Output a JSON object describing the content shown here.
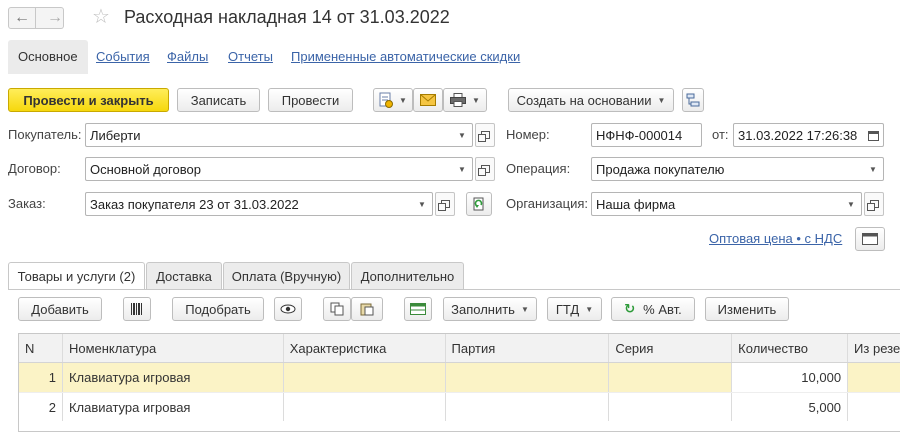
{
  "window": {
    "title": "Расходная накладная 14 от 31.03.2022"
  },
  "sections": [
    {
      "label": "Основное",
      "active": true
    },
    {
      "label": "События"
    },
    {
      "label": "Файлы"
    },
    {
      "label": "Отчеты"
    },
    {
      "label": "Примененные автоматические скидки"
    }
  ],
  "toolbar": {
    "post_close": "Провести и закрыть",
    "save": "Записать",
    "post": "Провести",
    "create_based": "Создать на основании"
  },
  "form": {
    "buyer": {
      "label": "Покупатель:",
      "value": "Либерти"
    },
    "contract": {
      "label": "Договор:",
      "value": "Основной договор"
    },
    "order": {
      "label": "Заказ:",
      "value": "Заказ покупателя 23 от 31.03.2022"
    },
    "number": {
      "label": "Номер:",
      "value": "НФНФ-000014"
    },
    "date": {
      "label": "от:",
      "value": "31.03.2022 17:26:38"
    },
    "operation": {
      "label": "Операция:",
      "value": "Продажа покупателю"
    },
    "organization": {
      "label": "Организация:",
      "value": "Наша фирма"
    },
    "price_type_link": "Оптовая цена • с НДС"
  },
  "tabs": [
    {
      "label": "Товары и услуги (2)",
      "active": true
    },
    {
      "label": "Доставка"
    },
    {
      "label": "Оплата (Вручную)"
    },
    {
      "label": "Дополнительно"
    }
  ],
  "goods_toolbar": {
    "add": "Добавить",
    "select": "Подобрать",
    "fill": "Заполнить",
    "gtd": "ГТД",
    "auto_discount": "% Авт.",
    "change": "Изменить"
  },
  "table": {
    "columns": [
      "N",
      "Номенклатура",
      "Характеристика",
      "Партия",
      "Серия",
      "Количество",
      "Из резе"
    ],
    "rows": [
      {
        "n": "1",
        "item": "Клавиатура игровая",
        "char": "",
        "batch": "",
        "series": "",
        "qty": "10,000",
        "reserve": ""
      },
      {
        "n": "2",
        "item": "Клавиатура игровая",
        "char": "",
        "batch": "",
        "series": "",
        "qty": "5,000",
        "reserve": ""
      }
    ]
  },
  "colors": {
    "primary": "#f6d80d",
    "link": "#3b64a8",
    "selected_row": "#fbf3c6"
  }
}
